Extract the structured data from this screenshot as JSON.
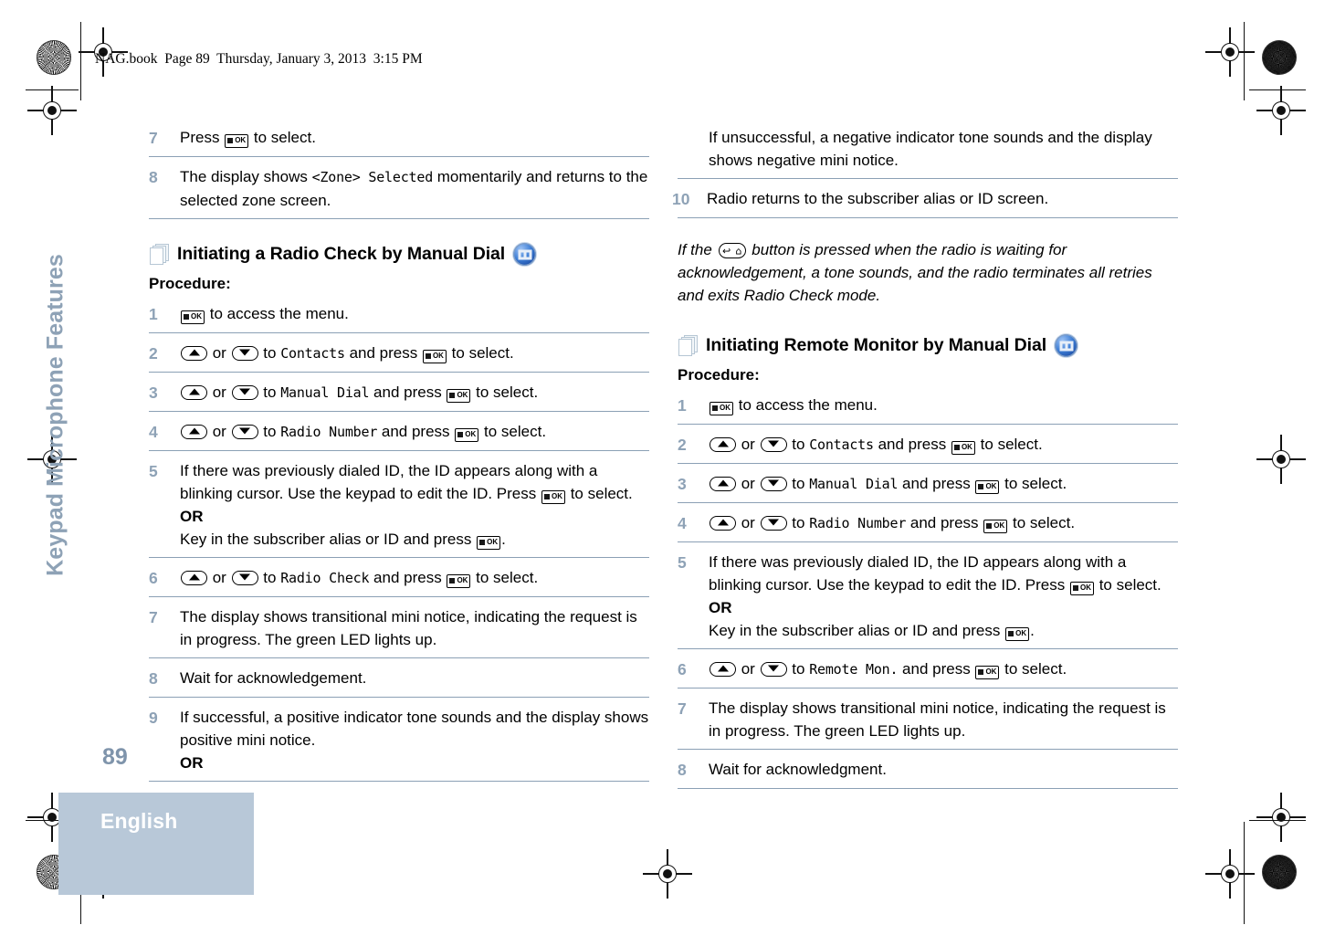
{
  "page": {
    "file_header": "NAG.book  Page 89  Thursday, January 3, 2013  3:15 PM",
    "page_number": "89",
    "chapter_tab": "Keypad Microphone Features",
    "language_tab": "English",
    "colors": {
      "rule": "#8ba0b5",
      "step_number": "#8ea2b6",
      "tab_background": "#b8c8d8",
      "tab_text": "#ffffff",
      "chapter_text": "#8ea2b6"
    }
  },
  "icons": {
    "ok_key": "ok-key-icon",
    "up_key": "up-arrow-key-icon",
    "down_key": "down-arrow-key-icon",
    "back_home_key": "back-home-key-icon",
    "pages": "stacked-pages-icon",
    "signal": "digital-signal-icon",
    "ok_label": "OK"
  },
  "left_column": {
    "continued_steps": [
      {
        "num": "7",
        "parts": [
          {
            "t": "text",
            "v": "Press "
          },
          {
            "t": "key",
            "v": "ok"
          },
          {
            "t": "text",
            "v": " to select."
          }
        ]
      },
      {
        "num": "8",
        "parts": [
          {
            "t": "text",
            "v": "The display shows "
          },
          {
            "t": "mono",
            "v": "<Zone> Selected"
          },
          {
            "t": "text",
            "v": " momentarily and returns to the selected zone screen."
          }
        ]
      }
    ],
    "section": {
      "title": "Initiating a Radio Check by Manual Dial",
      "procedure_label": "Procedure:",
      "steps": [
        {
          "num": "1",
          "parts": [
            {
              "t": "key",
              "v": "ok"
            },
            {
              "t": "text",
              "v": " to access the menu."
            }
          ]
        },
        {
          "num": "2",
          "parts": [
            {
              "t": "key",
              "v": "up"
            },
            {
              "t": "text",
              "v": " or "
            },
            {
              "t": "key",
              "v": "down"
            },
            {
              "t": "text",
              "v": " to "
            },
            {
              "t": "mono",
              "v": "Contacts"
            },
            {
              "t": "text",
              "v": " and press "
            },
            {
              "t": "key",
              "v": "ok"
            },
            {
              "t": "text",
              "v": " to select."
            }
          ]
        },
        {
          "num": "3",
          "parts": [
            {
              "t": "key",
              "v": "up"
            },
            {
              "t": "text",
              "v": " or "
            },
            {
              "t": "key",
              "v": "down"
            },
            {
              "t": "text",
              "v": " to "
            },
            {
              "t": "mono",
              "v": "Manual Dial"
            },
            {
              "t": "text",
              "v": " and press "
            },
            {
              "t": "key",
              "v": "ok"
            },
            {
              "t": "text",
              "v": " to select."
            }
          ]
        },
        {
          "num": "4",
          "parts": [
            {
              "t": "key",
              "v": "up"
            },
            {
              "t": "text",
              "v": " or "
            },
            {
              "t": "key",
              "v": "down"
            },
            {
              "t": "text",
              "v": " to "
            },
            {
              "t": "mono",
              "v": "Radio Number"
            },
            {
              "t": "text",
              "v": " and press "
            },
            {
              "t": "key",
              "v": "ok"
            },
            {
              "t": "text",
              "v": " to select."
            }
          ]
        },
        {
          "num": "5",
          "parts": [
            {
              "t": "text",
              "v": "If there was previously dialed ID, the ID appears along with a blinking cursor. Use the keypad to edit the ID. Press "
            },
            {
              "t": "key",
              "v": "ok"
            },
            {
              "t": "text",
              "v": " to select."
            },
            {
              "t": "br"
            },
            {
              "t": "bold",
              "v": "OR"
            },
            {
              "t": "br"
            },
            {
              "t": "text",
              "v": "Key in the subscriber alias or ID and press "
            },
            {
              "t": "key",
              "v": "ok"
            },
            {
              "t": "text",
              "v": "."
            }
          ]
        },
        {
          "num": "6",
          "parts": [
            {
              "t": "key",
              "v": "up"
            },
            {
              "t": "text",
              "v": " or "
            },
            {
              "t": "key",
              "v": "down"
            },
            {
              "t": "text",
              "v": " to "
            },
            {
              "t": "mono",
              "v": "Radio Check"
            },
            {
              "t": "text",
              "v": " and press "
            },
            {
              "t": "key",
              "v": "ok"
            },
            {
              "t": "text",
              "v": " to select."
            }
          ]
        },
        {
          "num": "7",
          "parts": [
            {
              "t": "text",
              "v": "The display shows transitional mini notice, indicating the request is in progress. The green LED lights up."
            }
          ]
        },
        {
          "num": "8",
          "parts": [
            {
              "t": "text",
              "v": "Wait for acknowledgement."
            }
          ]
        },
        {
          "num": "9",
          "parts": [
            {
              "t": "text",
              "v": "If successful, a positive indicator tone sounds and the display shows positive mini notice."
            },
            {
              "t": "br"
            },
            {
              "t": "bold",
              "v": "OR"
            }
          ]
        }
      ]
    }
  },
  "right_column": {
    "continued": {
      "paragraph": "If unsuccessful, a negative indicator tone sounds and the display shows negative mini notice.",
      "steps": [
        {
          "num": "10",
          "parts": [
            {
              "t": "text",
              "v": "Radio returns to the subscriber alias or ID screen."
            }
          ]
        }
      ],
      "note_parts": [
        {
          "t": "text",
          "v": "If the "
        },
        {
          "t": "key",
          "v": "back"
        },
        {
          "t": "text",
          "v": " button is pressed when the radio is waiting for acknowledgement, a tone sounds, and the radio terminates all retries and exits Radio Check mode."
        }
      ]
    },
    "section": {
      "title": "Initiating Remote Monitor by Manual Dial",
      "procedure_label": "Procedure:",
      "steps": [
        {
          "num": "1",
          "parts": [
            {
              "t": "key",
              "v": "ok"
            },
            {
              "t": "text",
              "v": " to access the menu."
            }
          ]
        },
        {
          "num": "2",
          "parts": [
            {
              "t": "key",
              "v": "up"
            },
            {
              "t": "text",
              "v": " or "
            },
            {
              "t": "key",
              "v": "down"
            },
            {
              "t": "text",
              "v": " to "
            },
            {
              "t": "mono",
              "v": "Contacts"
            },
            {
              "t": "text",
              "v": " and press "
            },
            {
              "t": "key",
              "v": "ok"
            },
            {
              "t": "text",
              "v": " to select."
            }
          ]
        },
        {
          "num": "3",
          "parts": [
            {
              "t": "key",
              "v": "up"
            },
            {
              "t": "text",
              "v": " or "
            },
            {
              "t": "key",
              "v": "down"
            },
            {
              "t": "text",
              "v": " to "
            },
            {
              "t": "mono",
              "v": "Manual Dial"
            },
            {
              "t": "text",
              "v": " and press "
            },
            {
              "t": "key",
              "v": "ok"
            },
            {
              "t": "text",
              "v": " to select."
            }
          ]
        },
        {
          "num": "4",
          "parts": [
            {
              "t": "key",
              "v": "up"
            },
            {
              "t": "text",
              "v": " or "
            },
            {
              "t": "key",
              "v": "down"
            },
            {
              "t": "text",
              "v": " to "
            },
            {
              "t": "mono",
              "v": "Radio Number"
            },
            {
              "t": "text",
              "v": " and press "
            },
            {
              "t": "key",
              "v": "ok"
            },
            {
              "t": "text",
              "v": " to select."
            }
          ]
        },
        {
          "num": "5",
          "parts": [
            {
              "t": "text",
              "v": "If there was previously dialed ID, the ID appears along with a blinking cursor. Use the keypad to edit the ID. Press "
            },
            {
              "t": "key",
              "v": "ok"
            },
            {
              "t": "text",
              "v": " to select."
            },
            {
              "t": "br"
            },
            {
              "t": "bold",
              "v": "OR"
            },
            {
              "t": "br"
            },
            {
              "t": "text",
              "v": "Key in the subscriber alias or ID and press "
            },
            {
              "t": "key",
              "v": "ok"
            },
            {
              "t": "text",
              "v": "."
            }
          ]
        },
        {
          "num": "6",
          "parts": [
            {
              "t": "key",
              "v": "up"
            },
            {
              "t": "text",
              "v": " or "
            },
            {
              "t": "key",
              "v": "down"
            },
            {
              "t": "text",
              "v": " to "
            },
            {
              "t": "mono",
              "v": "Remote Mon."
            },
            {
              "t": "text",
              "v": " and press "
            },
            {
              "t": "key",
              "v": "ok"
            },
            {
              "t": "text",
              "v": " to select."
            }
          ]
        },
        {
          "num": "7",
          "parts": [
            {
              "t": "text",
              "v": "The display shows transitional mini notice, indicating the request is in progress. The green LED lights up."
            }
          ]
        },
        {
          "num": "8",
          "parts": [
            {
              "t": "text",
              "v": "Wait for acknowledgment."
            }
          ]
        }
      ]
    }
  }
}
